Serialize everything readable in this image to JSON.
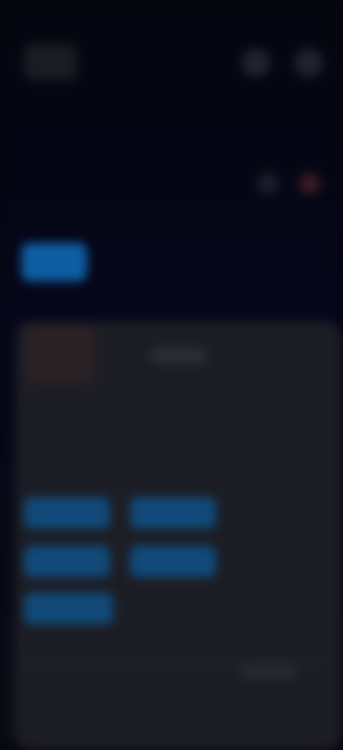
{
  "status_bar": {
    "time": "",
    "right": ""
  },
  "app_bar": {
    "title": ""
  },
  "summary": {
    "label": ""
  },
  "notice": {
    "text": ""
  },
  "primary_button": {
    "label": ""
  },
  "card": {
    "subtitle": "",
    "section_title": "",
    "section_desc": ""
  },
  "chips": [
    "",
    "",
    "",
    "",
    ""
  ],
  "footer": {
    "text": ""
  },
  "colors": {
    "background": "#06070f",
    "accent_blue": "#0e5ea3",
    "chip_blue": "#114a7a",
    "card": "#1c1d24"
  }
}
